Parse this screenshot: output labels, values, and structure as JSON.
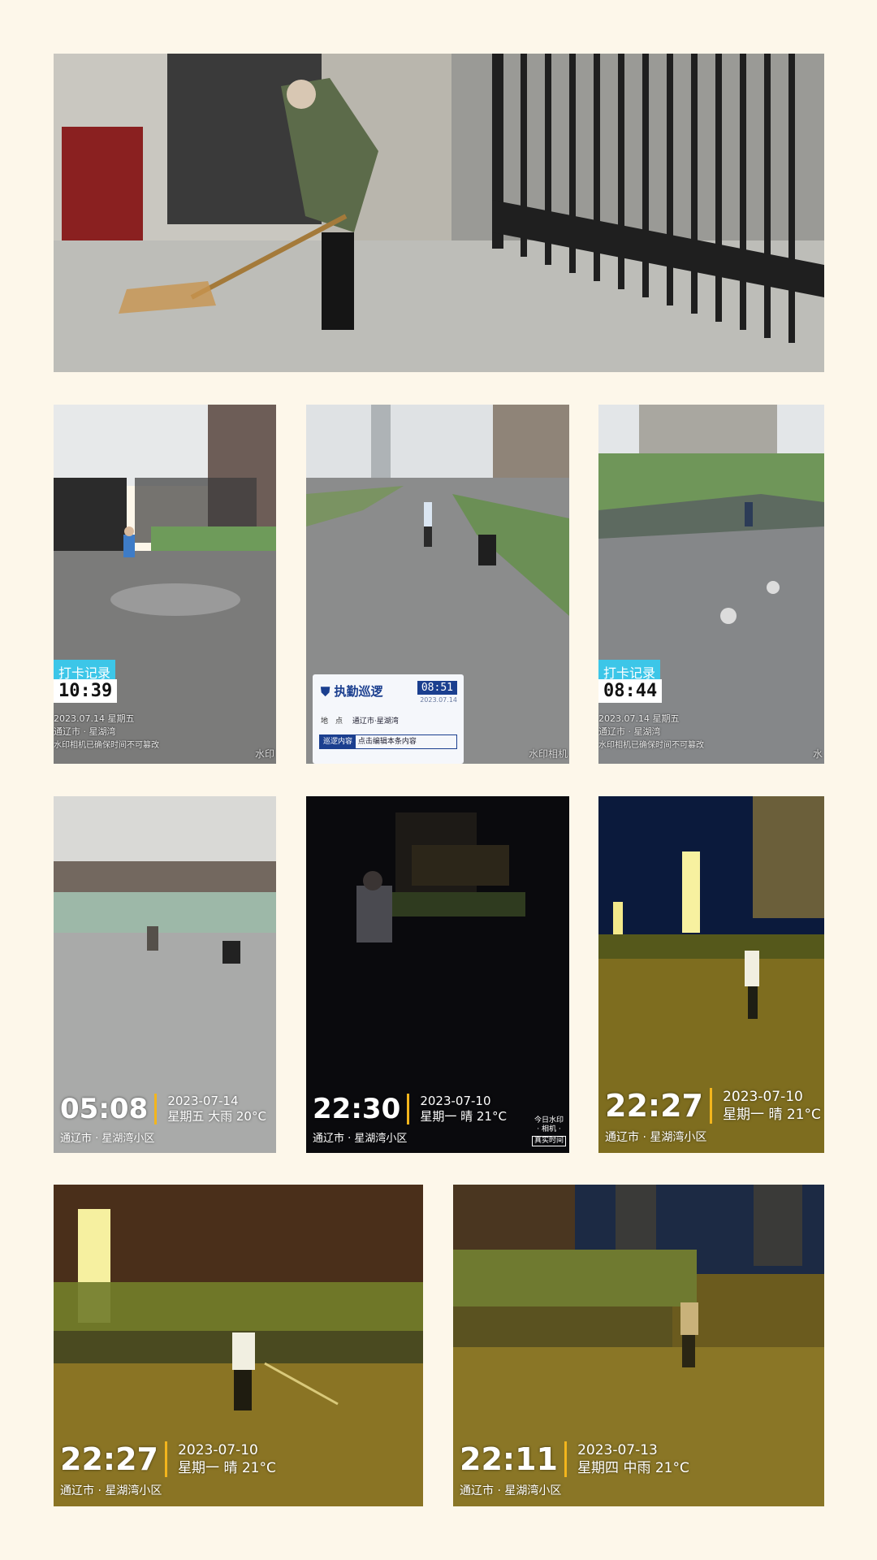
{
  "photos": {
    "p1": {
      "desc": ""
    },
    "p2": {
      "stamp_tag": "打卡记录",
      "stamp_time": "10:39",
      "stamp_date": "2023.07.14 星期五",
      "stamp_location": "通辽市 · 星湖湾",
      "stamp_note": "水印相机已确保时间不可篡改",
      "watermark": "水印"
    },
    "p3": {
      "card_title": "执勤巡逻",
      "card_time": "08:51",
      "card_date": "2023.07.14",
      "card_place_label": "地　点",
      "card_place_value": "通辽市·星湖湾",
      "card_content_label": "巡逻内容",
      "card_content_value": "点击编辑本条内容",
      "watermark": "水印相机"
    },
    "p4": {
      "stamp_tag": "打卡记录",
      "stamp_time": "08:44",
      "stamp_date": "2023.07.14 星期五",
      "stamp_location": "通辽市 · 星湖湾",
      "stamp_note": "水印相机已确保时间不可篡改",
      "watermark": "水"
    },
    "p5": {
      "time": "05:08",
      "date": "2023-07-14",
      "weekday_weather": "星期五 大雨 20°C",
      "location": "通辽市 · 星湖湾小区"
    },
    "p6": {
      "time": "22:30",
      "date": "2023-07-10",
      "weekday_weather": "星期一 晴 21°C",
      "location": "通辽市 · 星湖湾小区",
      "brand_line1": "今日水印",
      "brand_line2": "· 相机 ·",
      "brand_box": "真实时间"
    },
    "p7": {
      "time": "22:27",
      "date": "2023-07-10",
      "weekday_weather": "星期一 晴 21°C",
      "location": "通辽市 · 星湖湾小区"
    },
    "p8": {
      "time": "22:27",
      "date": "2023-07-10",
      "weekday_weather": "星期一 晴 21°C",
      "location": "通辽市 · 星湖湾小区"
    },
    "p9": {
      "time": "22:11",
      "date": "2023-07-13",
      "weekday_weather": "星期四 中雨 21°C",
      "location": "通辽市 · 星湖湾小区"
    }
  },
  "colors": {
    "background": "#fdf7ea",
    "accent_divider": "#f3b51c",
    "stamp_blue": "#3cc6e8",
    "card_blue": "#1b3f8f"
  }
}
